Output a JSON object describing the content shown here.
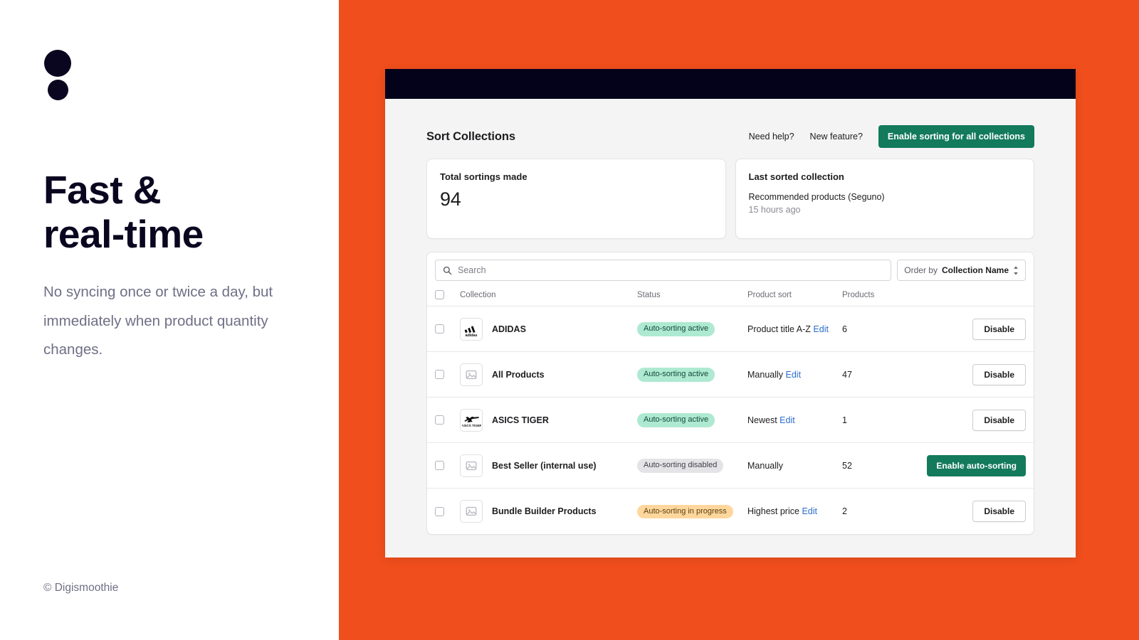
{
  "left": {
    "logo_icon": "two-dots-logo",
    "headline_line1": "Fast &",
    "headline_line2": "real-time",
    "subtext": "No syncing once or twice a day, but immediately when product quantity changes.",
    "copyright": "© Digismoothie"
  },
  "app": {
    "header": {
      "title": "Sort Collections",
      "links": [
        {
          "label": "Need help?"
        },
        {
          "label": "New feature?"
        }
      ],
      "primary_button": "Enable sorting for all collections"
    },
    "stats": [
      {
        "label": "Total sortings made",
        "value": "94"
      },
      {
        "label": "Last sorted collection",
        "primary": "Recommended products (Seguno)",
        "secondary": "15 hours ago"
      }
    ],
    "filters": {
      "search_placeholder": "Search",
      "search_value": "",
      "search_icon": "search-icon",
      "order_prefix": "Order by",
      "order_value": "Collection Name",
      "order_icon": "updown-chevron-icon"
    },
    "table": {
      "columns": {
        "collection": "Collection",
        "status": "Status",
        "product_sort": "Product sort",
        "products": "Products"
      },
      "rows": [
        {
          "thumb": "adidas-logo",
          "name": "ADIDAS",
          "status": "Auto-sorting active",
          "status_tone": "success",
          "sort": "Product title A-Z",
          "edit": "Edit",
          "has_edit": true,
          "products": "6",
          "action": "Disable",
          "action_tone": "secondary"
        },
        {
          "thumb": "image-placeholder-icon",
          "name": "All Products",
          "status": "Auto-sorting active",
          "status_tone": "success",
          "sort": "Manually",
          "edit": "Edit",
          "has_edit": true,
          "products": "47",
          "action": "Disable",
          "action_tone": "secondary"
        },
        {
          "thumb": "asics-tiger-logo",
          "name": "ASICS TIGER",
          "status": "Auto-sorting active",
          "status_tone": "success",
          "sort": "Newest",
          "edit": "Edit",
          "has_edit": true,
          "products": "1",
          "action": "Disable",
          "action_tone": "secondary"
        },
        {
          "thumb": "image-placeholder-icon",
          "name": "Best Seller (internal use)",
          "status": "Auto-sorting disabled",
          "status_tone": "neutral",
          "sort": "Manually",
          "edit": "",
          "has_edit": false,
          "products": "52",
          "action": "Enable auto-sorting",
          "action_tone": "primary"
        },
        {
          "thumb": "image-placeholder-icon",
          "name": "Bundle Builder Products",
          "status": "Auto-sorting in progress",
          "status_tone": "warning",
          "sort": "Highest price",
          "edit": "Edit",
          "has_edit": true,
          "products": "2",
          "action": "Disable",
          "action_tone": "secondary"
        }
      ]
    }
  },
  "colors": {
    "background_orange": "#f04e1c",
    "topbar_dark": "#04021a",
    "brand_green": "#137a5c",
    "link_blue": "#2c6ecb",
    "badge_success": "#aee9d1",
    "badge_neutral": "#e4e4e7",
    "badge_warning": "#ffd79d",
    "text_dark": "#0b0620",
    "text_muted": "#6f6f86"
  }
}
